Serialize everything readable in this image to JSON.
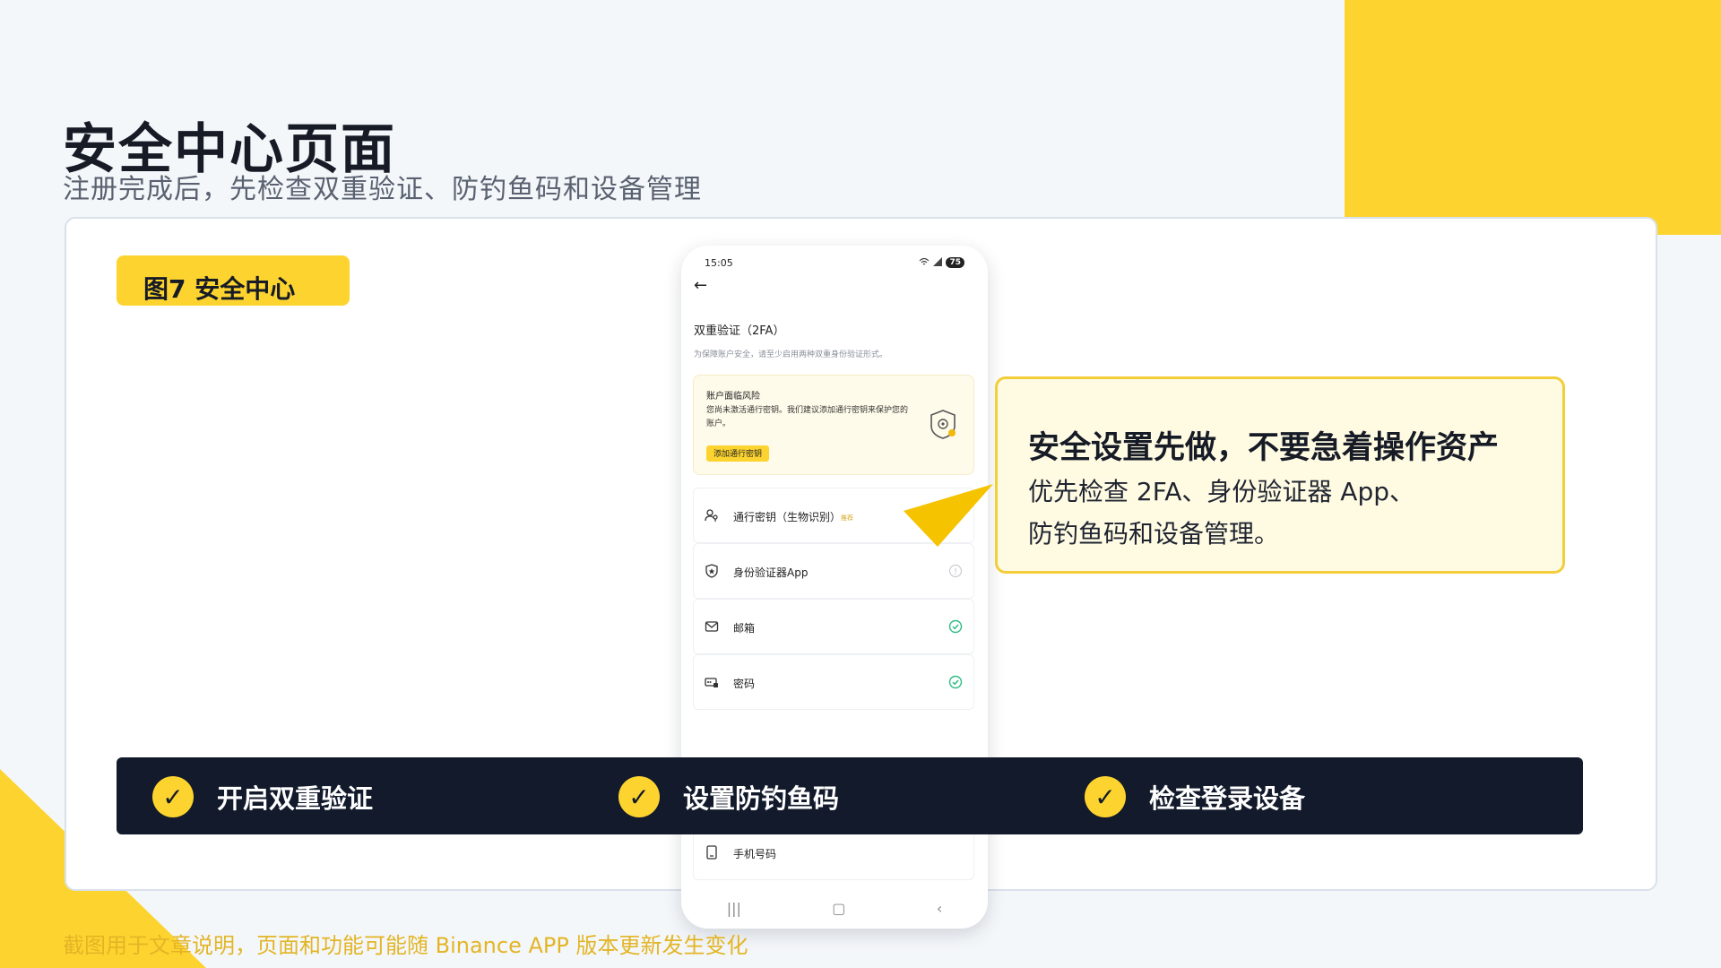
{
  "slide": {
    "title": "安全中心页面",
    "subtitle": "注册完成后，先检查双重验证、防钓鱼码和设备管理",
    "figure_tag": "图7 安全中心",
    "footnote": "截图用于文章说明，页面和功能可能随 Binance APP 版本更新发生变化",
    "accent_color": "#fdd42f",
    "dark_color": "#121a2b"
  },
  "phone": {
    "status_time": "15:05",
    "battery": "75",
    "twofa_title": "双重验证（2FA）",
    "twofa_desc": "为保障账户安全，请至少启用两种双重身份验证形式。",
    "risk": {
      "title": "账户面临风险",
      "text": "您尚未激活通行密钥。我们建议添加通行密钥来保护您的账户。",
      "button": "添加通行密钥"
    },
    "rows": [
      {
        "label": "通行密钥（生物识别）",
        "badge": "推荐",
        "icon": "passkey-icon",
        "status": "none"
      },
      {
        "label": "身份验证器App",
        "icon": "shield-icon",
        "status": "info"
      },
      {
        "label": "邮箱",
        "icon": "mail-icon",
        "status": "done"
      },
      {
        "label": "密码",
        "icon": "password-icon",
        "status": "done"
      },
      {
        "label": "手机号码",
        "icon": "phone-icon",
        "status": "none"
      }
    ],
    "status_done_color": "#2ebd85"
  },
  "callout": {
    "title": "安全设置先做，不要急着操作资产",
    "line1": "优先检查 2FA、身份验证器 App、",
    "line2": "防钓鱼码和设备管理。"
  },
  "checks": [
    {
      "label": "开启双重验证",
      "icon": "checkmark-icon"
    },
    {
      "label": "设置防钓鱼码",
      "icon": "checkmark-icon"
    },
    {
      "label": "检查登录设备",
      "icon": "checkmark-icon"
    }
  ]
}
